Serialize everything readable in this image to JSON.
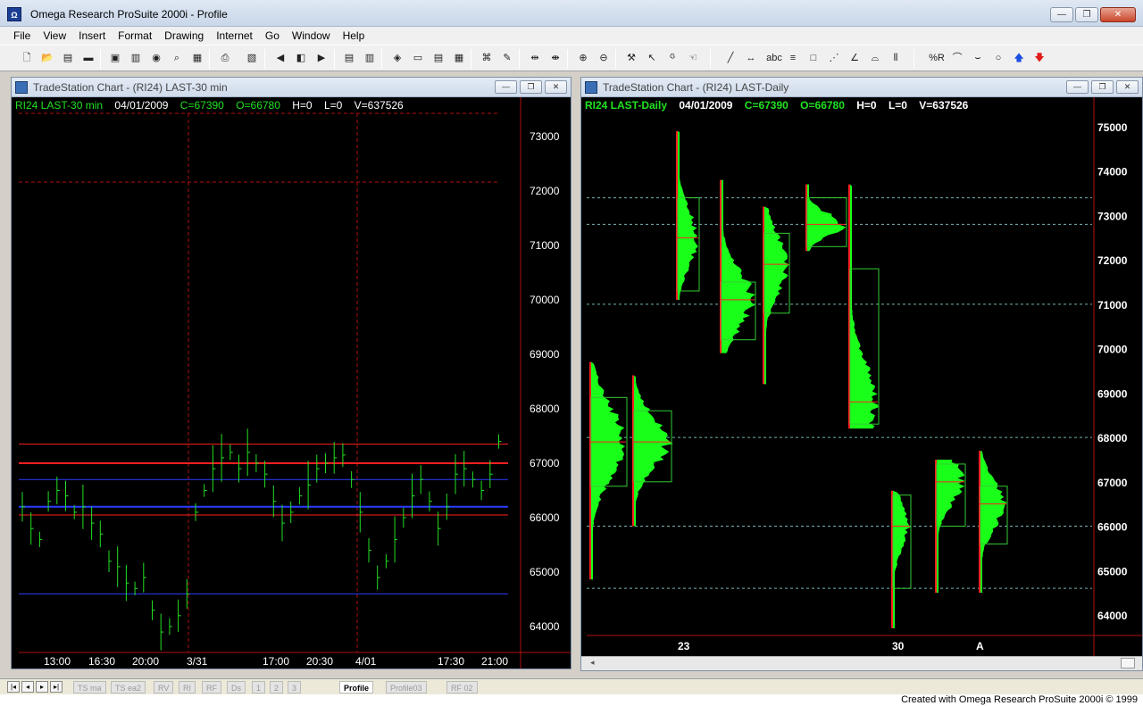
{
  "app": {
    "title": "Omega Research ProSuite 2000i - Profile",
    "icon_label": "Ω"
  },
  "window_controls": {
    "minimize": "—",
    "maximize": "❐",
    "close": "✕"
  },
  "menu": [
    "File",
    "View",
    "Insert",
    "Format",
    "Drawing",
    "Internet",
    "Go",
    "Window",
    "Help"
  ],
  "toolbar_text": {
    "abc": "abc",
    "pctR": "%R"
  },
  "left_chart": {
    "window_title": "TradeStation Chart - (RI24)  LAST-30 min",
    "info": {
      "symbol": "RI24 LAST-30 min",
      "date": "04/01/2009",
      "close": "C=67390",
      "open": "O=66780",
      "high": "H=0",
      "low": "L=0",
      "volume": "V=637526"
    },
    "y_ticks": [
      "73000",
      "72000",
      "71000",
      "70000",
      "69000",
      "68000",
      "67000",
      "66000",
      "65000",
      "64000"
    ],
    "x_ticks": [
      "13:00",
      "16:30",
      "20:00",
      "3/31",
      "17:00",
      "20:30",
      "4/01",
      "17:30",
      "21:00"
    ]
  },
  "right_chart": {
    "window_title": "TradeStation Chart - (RI24)  LAST-Daily",
    "info": {
      "symbol": "RI24 LAST-Daily",
      "date": "04/01/2009",
      "close": "C=67390",
      "open": "O=66780",
      "high": "H=0",
      "low": "L=0",
      "volume": "V=637526"
    },
    "y_ticks": [
      "75000",
      "74000",
      "73000",
      "72000",
      "71000",
      "70000",
      "69000",
      "68000",
      "67000",
      "66000",
      "65000",
      "64000"
    ],
    "x_ticks": [
      "23",
      "30",
      "A"
    ]
  },
  "bottom": {
    "tabs": [
      "TS ma",
      "TS ea2",
      "RV",
      "RI",
      "RF",
      "Ds",
      "1",
      "2",
      "3",
      "Profile",
      "Profile03",
      "RF 02"
    ],
    "active_tab": "Profile",
    "credit": "Created with Omega Research ProSuite 2000i © 1999"
  },
  "colors": {
    "chart_bg": "#000000",
    "bars": "#22e022",
    "levels_red": "#ff2020",
    "levels_blue": "#2a3cff",
    "profile_fill": "#19ff19",
    "profile_box": "#33cc33"
  }
}
